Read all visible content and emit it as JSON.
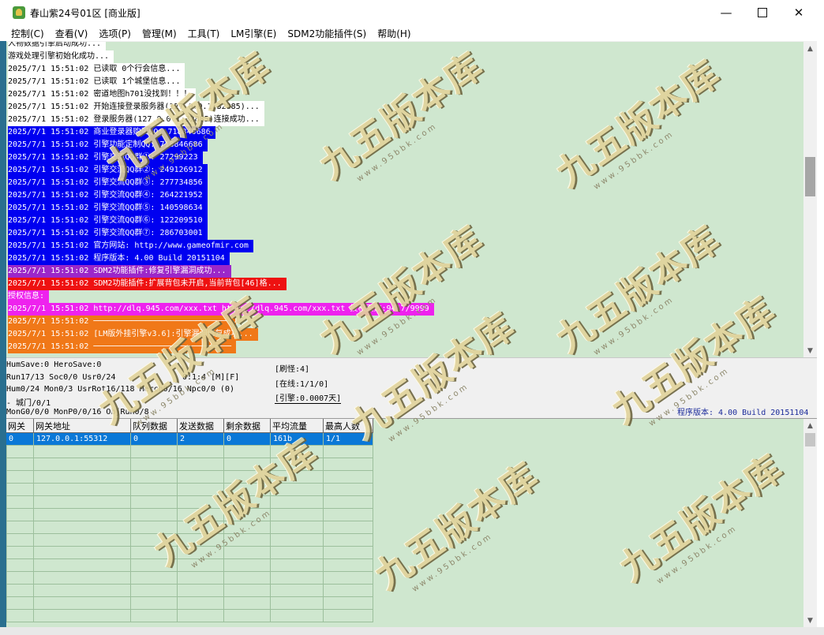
{
  "window": {
    "title": "春山紫24号01区 [商业版]",
    "minimize": "—",
    "close": "✕"
  },
  "menu": [
    "控制(C)",
    "查看(V)",
    "选项(P)",
    "管理(M)",
    "工具(T)",
    "LM引擎(E)",
    "SDM2功能插件(S)",
    "帮助(H)"
  ],
  "log": [
    {
      "text": "人物数据引擎启动成功...",
      "style": "w"
    },
    {
      "text": "游戏处理引擎初始化成功...",
      "style": "w"
    },
    {
      "text": "2025/7/1 15:51:02 已读取 0个行会信息...",
      "style": "w"
    },
    {
      "text": "2025/7/1 15:51:02 已读取 1个城堡信息...",
      "style": "w"
    },
    {
      "text": "2025/7/1 15:51:02 密道地图h701没找到！！！",
      "style": "w"
    },
    {
      "text": "2025/7/1 15:51:02 开始连接登录服务器(127.0.0.1:32885)...",
      "style": "w"
    },
    {
      "text": "2025/7/1 15:51:02 登录服务器(127.0.0.1:32885)连接成功...",
      "style": "w"
    },
    {
      "text": "2025/7/1 15:51:02 商业登录器购买QQ: 718846686",
      "style": "b"
    },
    {
      "text": "2025/7/1 15:51:02 引擎功能定制QQ: 718846686",
      "style": "b"
    },
    {
      "text": "2025/7/1 15:51:02 引擎交流QQ群①: 27299223",
      "style": "b"
    },
    {
      "text": "2025/7/1 15:51:02 引擎交流QQ群②: 249126912",
      "style": "b"
    },
    {
      "text": "2025/7/1 15:51:02 引擎交流QQ群③: 277734856",
      "style": "b"
    },
    {
      "text": "2025/7/1 15:51:02 引擎交流QQ群④: 264221952",
      "style": "b"
    },
    {
      "text": "2025/7/1 15:51:02 引擎交流QQ群⑤: 140598634",
      "style": "b"
    },
    {
      "text": "2025/7/1 15:51:02 引擎交流QQ群⑥: 122209510",
      "style": "b"
    },
    {
      "text": "2025/7/1 15:51:02 引擎交流QQ群⑦: 286703001",
      "style": "b"
    },
    {
      "text": "2025/7/1 15:51:02 官方网站: http://www.gameofmir.com",
      "style": "b"
    },
    {
      "text": "2025/7/1 15:51:02 程序版本: 4.00 Build 20151104",
      "style": "b"
    },
    {
      "text": "2025/7/1 15:51:02 SDM2功能插件:修复引擎漏洞成功...",
      "style": "p"
    },
    {
      "text": "2025/7/1 15:51:02 SDM2功能插件:扩展背包未开启,当前背包[46]格...",
      "style": "r"
    },
    {
      "text": "授权信息:",
      "style": "m"
    },
    {
      "text": "2025/7/1 15:51:02 http://dlq.945.com/xxx.txt http://dlq.945.com/xxx.txt 授权天数:9417/9999",
      "style": "m"
    },
    {
      "text": "2025/7/1 15:51:02 ─────────────────────────────",
      "style": "o"
    },
    {
      "text": "2025/7/1 15:51:02 [LM版外挂引擎v3.6]:引擎漏洞修复成功...",
      "style": "o"
    },
    {
      "text": "2025/7/1 15:51:02 ─────────────────────────────",
      "style": "o"
    }
  ],
  "status": {
    "save": "HumSave:0 HeroSave:0",
    "run": "Run17/13 Soc0/0 Usr0/24",
    "hum": "Hum0/24 Mon0/3 UsrRot16/118 Merch0/16 Npc0/0 (0)",
    "map": " - 城门/0/1",
    "mon": "MonG0/0/0 MonP0/0/16 ObjRun0/8",
    "timer": "0:1:4 [M][F]",
    "refresh": "[刷怪:4]",
    "online": "[在线:1/1/0]",
    "engine": "[引擎:0.0007天]",
    "version": "程序版本: 4.00 Build 20151104"
  },
  "gateway_table": {
    "headers": [
      "网关",
      "网关地址",
      "队列数据",
      "发送数据",
      "剩余数据",
      "平均流量",
      "最高人数"
    ],
    "rows": [
      [
        "0",
        "127.0.0.1:55312",
        "0",
        "2",
        "0",
        "161b",
        "1/1"
      ]
    ]
  },
  "watermark": {
    "big": "九五版本库",
    "small": "www.95bbk.com"
  }
}
